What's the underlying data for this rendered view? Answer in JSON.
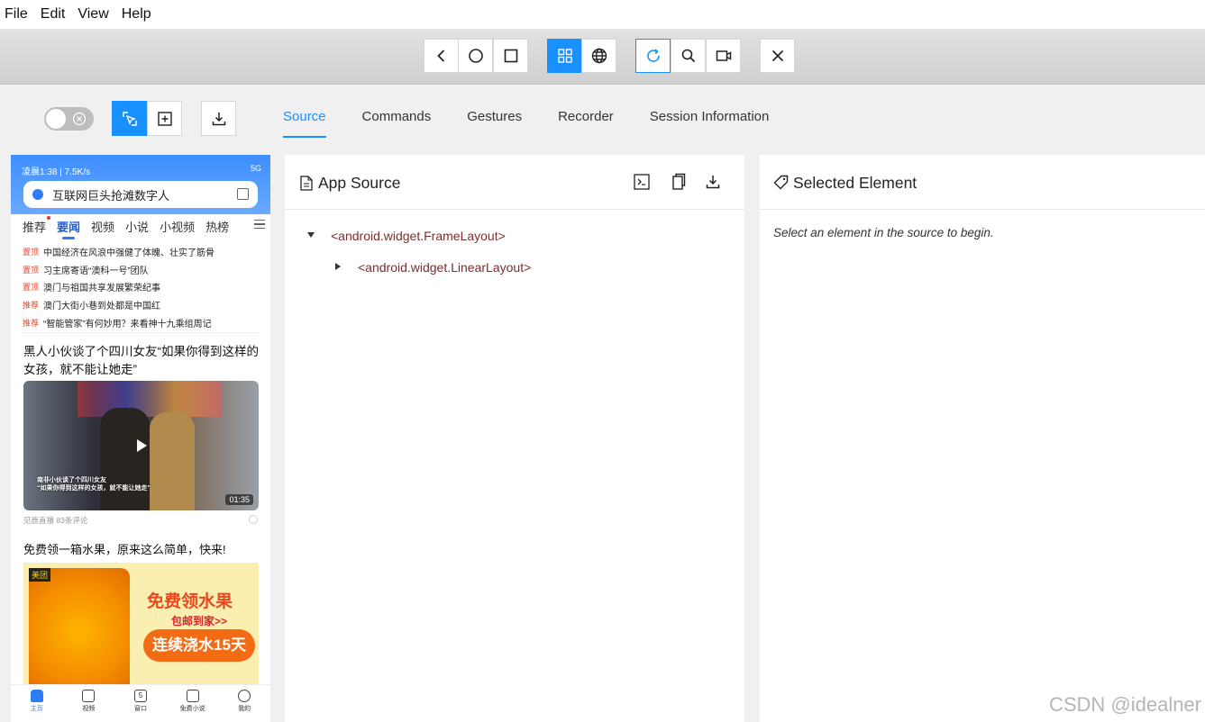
{
  "menu": [
    "File",
    "Edit",
    "View",
    "Help"
  ],
  "toolbar": {
    "buttons": [
      "back-icon",
      "home-circle-icon",
      "square-icon",
      "grid-icon",
      "globe-icon",
      "refresh-icon",
      "search-icon",
      "video-icon",
      "close-icon"
    ],
    "accent": "#1890ff"
  },
  "tabs": [
    "Source",
    "Commands",
    "Gestures",
    "Recorder",
    "Session Information"
  ],
  "active_tab": "Source",
  "phone": {
    "status_left": "凌晨1:38 | 7.5K/s",
    "status_right": "5G",
    "search_text": "互联网巨头抢滩数字人",
    "nav_tabs": [
      "推荐",
      "要闻",
      "视频",
      "小说",
      "小视频",
      "热榜"
    ],
    "headlines": [
      {
        "tag": "置顶",
        "text": "中国经济在风浪中强健了体魄、壮实了筋骨"
      },
      {
        "tag": "置顶",
        "text": "习主席寄语“澳科一号”团队"
      },
      {
        "tag": "置顶",
        "text": "澳门与祖国共享发展繁荣纪事"
      },
      {
        "tag": "推荐",
        "text": "澳门大街小巷到处都是中国红"
      },
      {
        "tag": "推荐",
        "text": "“智能管家”有何妙用？来看神十九乘组周记"
      }
    ],
    "article1_title": "黑人小伙谈了个四川女友“如果你得到这样的女孩，就不能让她走”",
    "video_caption_1": "南非小伙谈了个四川女友",
    "video_caption_2": "“如果你得到这样的女孩，就不能让她走”",
    "video_duration": "01:35",
    "article1_meta": "见鹿直播  83条评论",
    "article2_title": "免费领一箱水果，原来这么简单，快来!",
    "ad_brand": "美团",
    "ad_line1": "免费领水果",
    "ad_line2": "包邮到家>>",
    "ad_line3": "连续浇水15天",
    "bottom_nav": [
      "主页",
      "视频",
      "窗口",
      "免费小说",
      "我的"
    ],
    "window_count": "5"
  },
  "source_panel": {
    "title": "App Source",
    "nodes": [
      "<android.widget.FrameLayout>",
      "<android.widget.LinearLayout>"
    ]
  },
  "selected_panel": {
    "title": "Selected Element",
    "hint": "Select an element in the source to begin."
  },
  "watermark": "CSDN @idealner"
}
